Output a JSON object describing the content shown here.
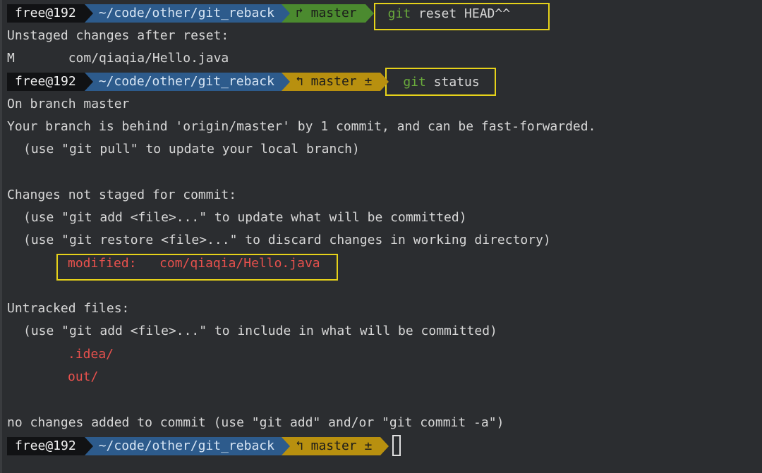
{
  "prompts": [
    {
      "user": "free@192",
      "path": "~/code/other/git_reback",
      "branch": "↱ master",
      "state": "clean",
      "cmd_git": "git",
      "cmd_rest": " reset HEAD^^"
    },
    {
      "user": "free@192",
      "path": "~/code/other/git_reback",
      "branch": "↰ master ±",
      "state": "dirty",
      "cmd_git": "git",
      "cmd_rest": " status"
    },
    {
      "user": "free@192",
      "path": "~/code/other/git_reback",
      "branch": "↰ master ±",
      "state": "dirty",
      "cmd_git": "",
      "cmd_rest": ""
    }
  ],
  "output": {
    "unstaged_header": "Unstaged changes after reset:",
    "unstaged_entry": "M       com/qiaqia/Hello.java",
    "on_branch": "On branch master",
    "behind": "Your branch is behind 'origin/master' by 1 commit, and can be fast-forwarded.",
    "pull_hint": "(use \"git pull\" to update your local branch)",
    "not_staged_header": "Changes not staged for commit:",
    "add_hint": "(use \"git add <file>...\" to update what will be committed)",
    "restore_hint": "(use \"git restore <file>...\" to discard changes in working directory)",
    "modified_entry": "modified:   com/qiaqia/Hello.java",
    "untracked_header": "Untracked files:",
    "include_hint": "(use \"git add <file>...\" to include in what will be committed)",
    "untracked_files": [
      ".idea/",
      "out/"
    ],
    "no_changes": "no changes added to commit (use \"git add\" and/or \"git commit -a\")"
  },
  "colors": {
    "background": "#2b2d30",
    "text": "#d7d7d7",
    "git_keyword": "#6aab3c",
    "modified_red": "#e8514d",
    "highlight_box": "#e6d21a",
    "path_segment": "#2d5b8c",
    "branch_clean": "#4b8a2f",
    "branch_dirty": "#b8900f"
  }
}
